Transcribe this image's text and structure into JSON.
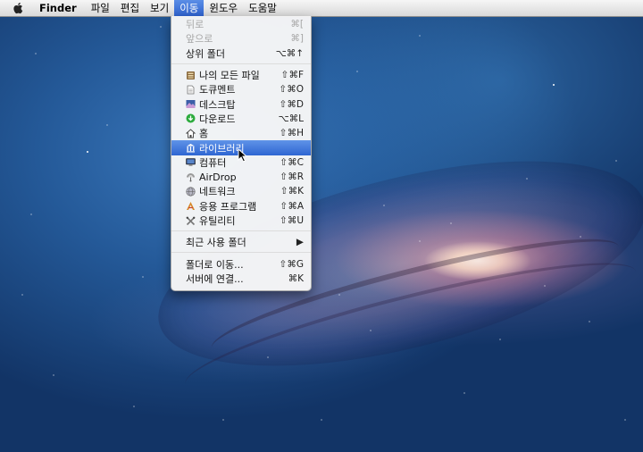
{
  "menubar": {
    "app_name": "Finder",
    "items": [
      "파일",
      "편집",
      "보기",
      "이동",
      "윈도우",
      "도움말"
    ],
    "active_item": "이동"
  },
  "go_menu": {
    "nav": [
      {
        "label": "뒤로",
        "shortcut": "⌘[",
        "disabled": true
      },
      {
        "label": "앞으로",
        "shortcut": "⌘]",
        "disabled": true
      },
      {
        "label": "상위 폴더",
        "shortcut": "⌥⌘↑",
        "disabled": false
      }
    ],
    "places": [
      {
        "label": "나의 모든 파일",
        "shortcut": "⇧⌘F",
        "icon": "all-my-files-icon"
      },
      {
        "label": "도큐멘트",
        "shortcut": "⇧⌘O",
        "icon": "documents-icon"
      },
      {
        "label": "데스크탑",
        "shortcut": "⇧⌘D",
        "icon": "desktop-icon"
      },
      {
        "label": "다운로드",
        "shortcut": "⌥⌘L",
        "icon": "downloads-icon"
      },
      {
        "label": "홈",
        "shortcut": "⇧⌘H",
        "icon": "home-icon"
      },
      {
        "label": "라이브러리",
        "shortcut": "",
        "icon": "library-icon",
        "highlighted": true
      },
      {
        "label": "컴퓨터",
        "shortcut": "⇧⌘C",
        "icon": "computer-icon"
      },
      {
        "label": "AirDrop",
        "shortcut": "⇧⌘R",
        "icon": "airdrop-icon"
      },
      {
        "label": "네트워크",
        "shortcut": "⇧⌘K",
        "icon": "network-icon"
      },
      {
        "label": "응용 프로그램",
        "shortcut": "⇧⌘A",
        "icon": "applications-icon"
      },
      {
        "label": "유틸리티",
        "shortcut": "⇧⌘U",
        "icon": "utilities-icon"
      }
    ],
    "recent": {
      "label": "최근 사용 폴더",
      "arrow": "▶"
    },
    "goto": [
      {
        "label": "폴더로 이동...",
        "shortcut": "⇧⌘G"
      },
      {
        "label": "서버에 연결...",
        "shortcut": "⌘K"
      }
    ]
  },
  "colors": {
    "highlight": "#3a70d8",
    "menubar": "#e6e6e6",
    "desktop_blue": "#245998"
  }
}
